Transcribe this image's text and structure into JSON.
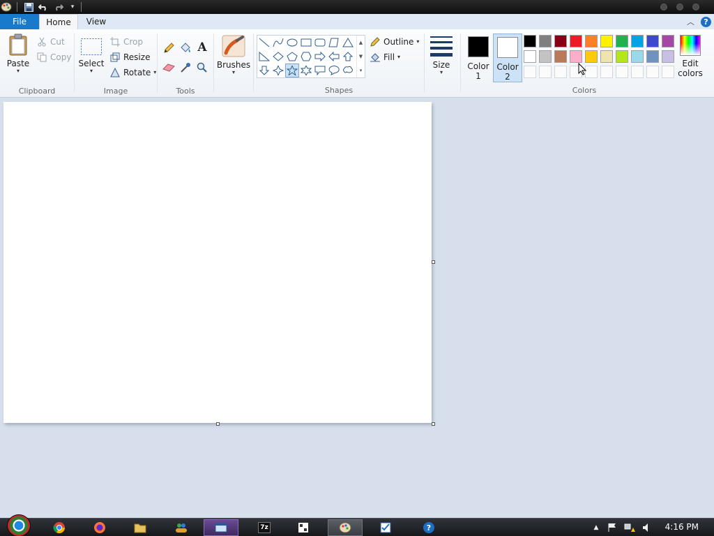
{
  "app": {
    "name": "Paint"
  },
  "tabs": {
    "file": "File",
    "home": "Home",
    "view": "View"
  },
  "clipboard": {
    "paste": "Paste",
    "cut": "Cut",
    "copy": "Copy",
    "group_label": "Clipboard"
  },
  "image": {
    "select": "Select",
    "crop": "Crop",
    "resize": "Resize",
    "rotate": "Rotate",
    "group_label": "Image"
  },
  "tools": {
    "group_label": "Tools"
  },
  "brushes": {
    "label": "Brushes"
  },
  "shapes": {
    "outline": "Outline",
    "fill": "Fill",
    "group_label": "Shapes",
    "selected_shape": "five-point-star"
  },
  "size": {
    "label": "Size"
  },
  "colors": {
    "color1_label_line1": "Color",
    "color1_label_line2": "1",
    "color2_label_line1": "Color",
    "color2_label_line2": "2",
    "color1_value": "#000000",
    "color2_value": "#ffffff",
    "edit_line1": "Edit",
    "edit_line2": "colors",
    "group_label": "Colors",
    "palette_row1": [
      "#000000",
      "#7f7f7f",
      "#880015",
      "#ed1c24",
      "#ff7f27",
      "#fff200",
      "#22b14c",
      "#00a2e8",
      "#3f48cc",
      "#a349a4"
    ],
    "palette_row2": [
      "#ffffff",
      "#c3c3c3",
      "#b97a57",
      "#ffaec9",
      "#ffc90e",
      "#efe4b0",
      "#b5e61d",
      "#99d9ea",
      "#7092be",
      "#c8bfe7"
    ],
    "palette_row3_empty": 10
  },
  "taskbar": {
    "clock": "4:16 PM"
  }
}
